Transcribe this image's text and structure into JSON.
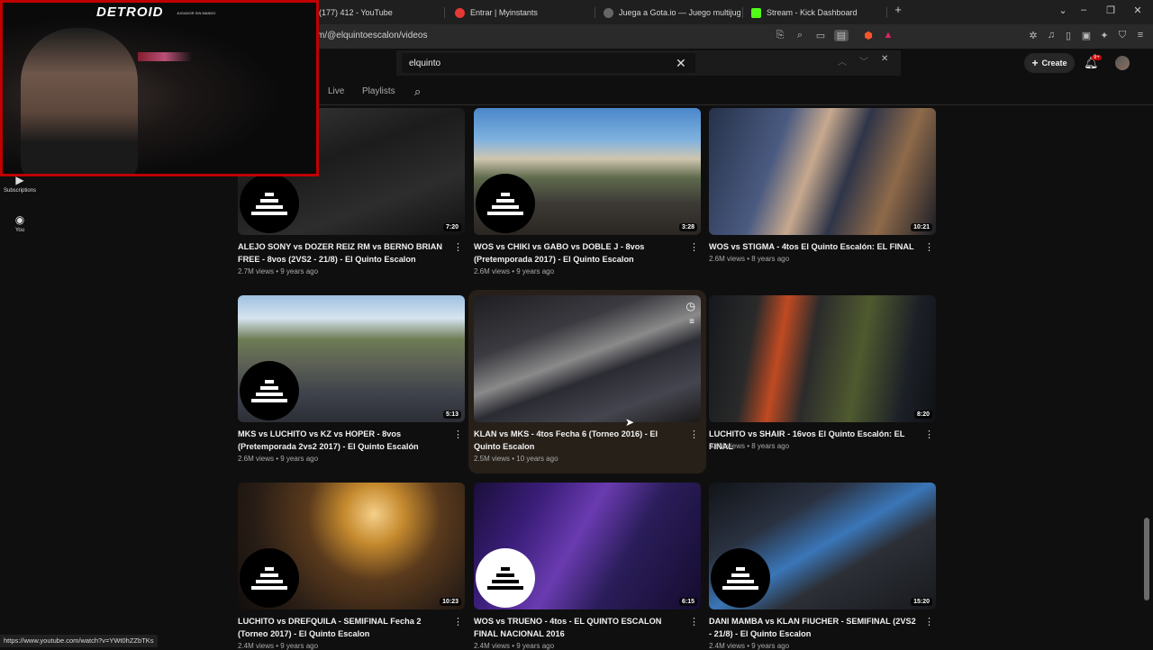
{
  "browser": {
    "tabs": [
      {
        "label": "(177) 412 - YouTube",
        "color": "#ff0000"
      },
      {
        "label": "Entrar | Myinstants",
        "color": "#e53935"
      },
      {
        "label": "Juega a Gota.io — Juego multijugado",
        "color": "#333333"
      },
      {
        "label": "Stream - Kick Dashboard",
        "color": "#53fc18"
      }
    ],
    "new_tab": "+",
    "url": "m/@elquintoescalon/videos",
    "status_url": "https://www.youtube.com/watch?v=YWt0hZZbTKs"
  },
  "find": {
    "query": "elquinto",
    "close": "✕"
  },
  "header": {
    "create_label": "Create",
    "notif_badge": "9+"
  },
  "channel_tabs": {
    "live": "Live",
    "playlists": "Playlists"
  },
  "sidebar": {
    "subscriptions": "Subscriptions",
    "you": "You"
  },
  "webcam": {
    "title": "DETROID",
    "subtitle": "JUGADOR SIN MANDO"
  },
  "videos": [
    {
      "title": "ALEJO SONY vs DOZER REIZ RM vs BERNO BRIAN FREE - 8vos (2VS2 - 21/8) - El Quinto Escalon",
      "meta": "2.7M views • 9 years ago",
      "duration": "7:20"
    },
    {
      "title": "WOS vs CHIKI vs GABO vs DOBLE J - 8vos (Pretemporada 2017) - El Quinto Escalon",
      "meta": "2.6M views • 9 years ago",
      "duration": "3:28"
    },
    {
      "title": "WOS vs STIGMA - 4tos El Quinto Escalón: EL FINAL",
      "meta": "2.6M views • 8 years ago",
      "duration": "10:21"
    },
    {
      "title": "MKS vs LUCHITO vs KZ vs HOPER - 8vos (Pretemporada 2vs2 2017) - El Quinto Escalón",
      "meta": "2.6M views • 9 years ago",
      "duration": "5:13"
    },
    {
      "title": "KLAN vs MKS - 4tos Fecha 6 (Torneo 2016) - El Quinto Escalon",
      "meta": "2.5M views • 10 years ago",
      "duration": ""
    },
    {
      "title": "LUCHITO vs SHAIR - 16vos El Quinto Escalón: EL FINAL",
      "meta": "2.4M views • 8 years ago",
      "duration": "8:20"
    },
    {
      "title": "LUCHITO vs DREFQUILA - SEMIFINAL Fecha 2 (Torneo 2017) - El Quinto Escalon",
      "meta": "2.4M views • 9 years ago",
      "duration": "10:23"
    },
    {
      "title": "WOS vs TRUENO - 4tos - EL QUINTO ESCALON FINAL NACIONAL 2016",
      "meta": "2.4M views • 9 years ago",
      "duration": "6:15"
    },
    {
      "title": "DANI MAMBA vs KLAN FIUCHER - SEMIFINAL (2VS2 - 21/8) - El Quinto Escalon",
      "meta": "2.4M views • 9 years ago",
      "duration": "15:20"
    }
  ]
}
